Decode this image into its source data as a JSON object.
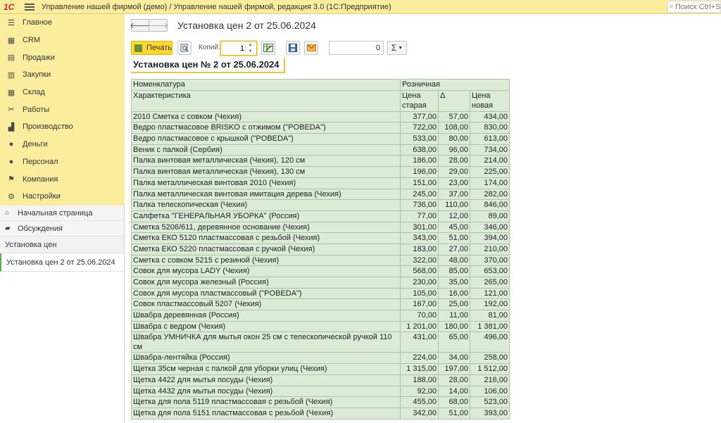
{
  "app": {
    "logo": "1С",
    "window_title": "Управление нашей фирмой (демо) / Управление нашей фирмой, редакция 3.0  (1С:Предприятие)",
    "search_placeholder": "Поиск Ctrl+Shift+F"
  },
  "sidebar": {
    "sections": [
      {
        "label": "Главное",
        "icon": "menu-icon"
      },
      {
        "label": "CRM",
        "icon": "crm-icon"
      },
      {
        "label": "Продажи",
        "icon": "sales-icon"
      },
      {
        "label": "Закупки",
        "icon": "purchases-icon"
      },
      {
        "label": "Склад",
        "icon": "warehouse-icon"
      },
      {
        "label": "Работы",
        "icon": "works-icon"
      },
      {
        "label": "Производство",
        "icon": "production-icon"
      },
      {
        "label": "Деньги",
        "icon": "money-icon"
      },
      {
        "label": "Персонал",
        "icon": "personnel-icon"
      },
      {
        "label": "Компания",
        "icon": "company-icon"
      },
      {
        "label": "Настройки",
        "icon": "gear-icon"
      }
    ],
    "nav": {
      "home_label": "Начальная страница",
      "discussions_label": "Обсуждения",
      "group_label": "Установка цен",
      "open_doc_label": "Установка цен 2 от 25.06.2024"
    }
  },
  "document": {
    "title": "Установка цен 2 от 25.06.2024"
  },
  "toolbar": {
    "print_label": "Печать",
    "copies_label": "Копий:",
    "copies_value": "1",
    "sum_value": "0",
    "sigma_label": "Σ"
  },
  "report": {
    "title": "Установка цен № 2 от 25.06.2024",
    "header": {
      "col_nomenclature": "Номенклатура",
      "col_characteristic": "Характеристика",
      "group_retail": "Розничная",
      "col_old": "Цена старая",
      "col_delta": "Δ",
      "col_new": "Цена новая"
    },
    "rows": [
      [
        "2010 Сметка с совком (Чехия)",
        "377,00",
        "57,00",
        "434,00"
      ],
      [
        "Ведро пластмасовое BRISKO с отжимом (\"POBEDA\")",
        "722,00",
        "108,00",
        "830,00"
      ],
      [
        "Ведро пластмасовое с крышкой (\"POBEDA\")",
        "533,00",
        "80,00",
        "613,00"
      ],
      [
        "Веник с палкой (Сербия)",
        "638,00",
        "96,00",
        "734,00"
      ],
      [
        "Палка винтовая металлическая (Чехия), 120 см",
        "186,00",
        "28,00",
        "214,00"
      ],
      [
        "Палка винтовая металлическая (Чехия), 130 см",
        "196,00",
        "29,00",
        "225,00"
      ],
      [
        "Палка металлическая винтовая 2010 (Чехия)",
        "151,00",
        "23,00",
        "174,00"
      ],
      [
        "Палка металлическая винтовая имитация дерева (Чехия)",
        "245,00",
        "37,00",
        "282,00"
      ],
      [
        "Палка телескопическая (Чехия)",
        "736,00",
        "110,00",
        "846,00"
      ],
      [
        "Салфетка \"ГЕНЕРАЛЬНАЯ УБОРКА\" (Россия)",
        "77,00",
        "12,00",
        "89,00"
      ],
      [
        "Сметка 5206/611, деревянное основание (Чехия)",
        "301,00",
        "45,00",
        "346,00"
      ],
      [
        "Сметка ЕКО 5120 пластмассовая с резьбой (Чехия)",
        "343,00",
        "51,00",
        "394,00"
      ],
      [
        "Сметка ЕКО 5220 пластмассовая с ручкой (Чехия)",
        "183,00",
        "27,00",
        "210,00"
      ],
      [
        "Сметка с совком 5215 с резиной (Чехия)",
        "322,00",
        "48,00",
        "370,00"
      ],
      [
        "Совок для мусора LADY (Чехия)",
        "568,00",
        "85,00",
        "653,00"
      ],
      [
        "Совок для мусора железный (Россия)",
        "230,00",
        "35,00",
        "265,00"
      ],
      [
        "Совок для мусора пластмассовый (\"POBEDA\")",
        "105,00",
        "16,00",
        "121,00"
      ],
      [
        "Совок пластмассовый 5207 (Чехия)",
        "167,00",
        "25,00",
        "192,00"
      ],
      [
        "Швабра деревянная (Россия)",
        "70,00",
        "11,00",
        "81,00"
      ],
      [
        "Швабра с ведром (Чехия)",
        "1 201,00",
        "180,00",
        "1 381,00"
      ],
      [
        "Швабра УМНИЧКА для мытья окон 25 см с телескопической ручкой 110 см",
        "431,00",
        "65,00",
        "496,00"
      ],
      [
        "Швабра-лентяйка (Россия)",
        "224,00",
        "34,00",
        "258,00"
      ],
      [
        "Щетка 35см черная с палкой для уборки улиц (Чехия)",
        "1 315,00",
        "197,00",
        "1 512,00"
      ],
      [
        "Щетка 4422 для мытья посуды (Чехия)",
        "188,00",
        "28,00",
        "216,00"
      ],
      [
        "Щетка 4432 для мытья посуды (Чехия)",
        "92,00",
        "14,00",
        "106,00"
      ],
      [
        "Щетка для пола 5119 пластмассовая с резьбой (Чехия)",
        "455,00",
        "68,00",
        "523,00"
      ],
      [
        "Щетка для пола 5151 пластмассовая с резьбой (Чехия)",
        "342,00",
        "51,00",
        "393,00"
      ]
    ]
  }
}
